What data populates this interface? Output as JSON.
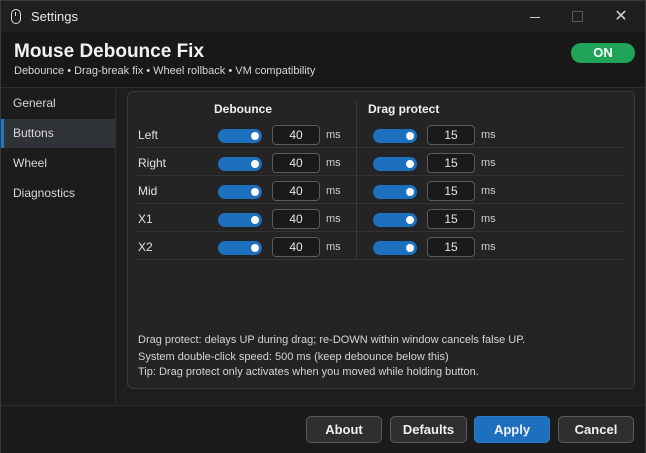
{
  "window": {
    "title": "Settings",
    "close_glyph": "✕",
    "icons": {
      "app": "mouse-icon",
      "minimize": "minimize-icon",
      "maximize": "maximize-icon",
      "close": "close-icon"
    }
  },
  "header": {
    "title": "Mouse Debounce Fix",
    "subtitle": "Debounce • Drag-break fix • Wheel rollback • VM compatibility",
    "status": "ON",
    "status_color": "#1fa45a"
  },
  "sidebar": {
    "items": [
      {
        "label": "General",
        "active": false
      },
      {
        "label": "Buttons",
        "active": true
      },
      {
        "label": "Wheel",
        "active": false
      },
      {
        "label": "Diagnostics",
        "active": false
      }
    ]
  },
  "buttons_table": {
    "debounce_header": "Debounce",
    "drag_header": "Drag protect",
    "unit": "ms",
    "rows": [
      {
        "label": "Left",
        "debounce_enabled": true,
        "debounce_ms": "40",
        "drag_enabled": true,
        "drag_ms": "15"
      },
      {
        "label": "Right",
        "debounce_enabled": true,
        "debounce_ms": "40",
        "drag_enabled": true,
        "drag_ms": "15"
      },
      {
        "label": "Mid",
        "debounce_enabled": true,
        "debounce_ms": "40",
        "drag_enabled": true,
        "drag_ms": "15"
      },
      {
        "label": "X1",
        "debounce_enabled": true,
        "debounce_ms": "40",
        "drag_enabled": true,
        "drag_ms": "15"
      },
      {
        "label": "X2",
        "debounce_enabled": true,
        "debounce_ms": "40",
        "drag_enabled": true,
        "drag_ms": "15"
      }
    ]
  },
  "notes": {
    "drag": "Drag protect: delays UP during drag; re-DOWN within window cancels false UP.",
    "doubleclick": "System double-click speed: 500 ms  (keep debounce below this)",
    "tip": "Tip: Drag protect only activates when you moved while holding button."
  },
  "footer": {
    "about": "About",
    "defaults": "Defaults",
    "apply": "Apply",
    "cancel": "Cancel"
  },
  "colors": {
    "accent": "#1f6fbf",
    "on_green": "#1fa45a"
  }
}
